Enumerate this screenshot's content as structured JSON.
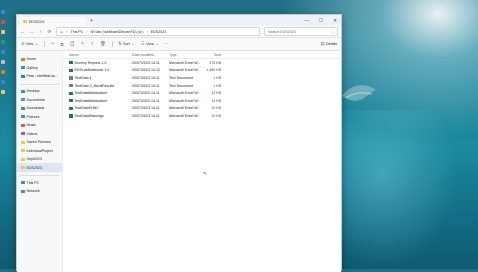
{
  "window": {
    "tab_title": "EDS2023",
    "win_controls": [
      "—",
      "☐",
      "✕"
    ],
    "new_tab": "+"
  },
  "address": {
    "crumbs": [
      "This PC",
      "NYJah (\\\\vMikael\\Drivrar\\FD) (U:)",
      "EDS2023"
    ],
    "search_placeholder": "Search EDS2023"
  },
  "toolbar": {
    "new": "New",
    "sort": "Sort",
    "view": "View",
    "more": "···",
    "details": "Details"
  },
  "sidebar": {
    "top": [
      {
        "label": "Home",
        "color": "#e77b27"
      },
      {
        "label": "Gallery",
        "color": "#3b8ad9"
      },
      {
        "label": "Peta - sheffield.ac...",
        "color": "#2f7ec9"
      }
    ],
    "quick": [
      {
        "label": "Desktop",
        "color": "#3a8bd6"
      },
      {
        "label": "Documents",
        "color": "#6b8fb3"
      },
      {
        "label": "Downloads",
        "color": "#2e9e5b"
      },
      {
        "label": "Pictures",
        "color": "#3b8ad9"
      },
      {
        "label": "Music",
        "color": "#e0584c"
      },
      {
        "label": "Videos",
        "color": "#8a5bd6"
      },
      {
        "label": "Saved Pictures",
        "color": "#f2c94c"
      },
      {
        "label": "IndividualProject",
        "color": "#f2c94c"
      },
      {
        "label": "Sept2023",
        "color": "#f2c94c"
      },
      {
        "label": "EDS2023",
        "color": "#f2c94c"
      }
    ],
    "bottom": [
      {
        "label": "This PC",
        "color": "#3a8bd6"
      },
      {
        "label": "Network",
        "color": "#3a8bd6"
      }
    ],
    "selected": "EDS2023"
  },
  "filelist": {
    "headers": [
      "Name",
      "Date modified",
      "Type",
      "Size"
    ],
    "rows": [
      {
        "name": "Dummy Reports 1.0",
        "date": "20/07/2023 14:11",
        "type": "Microsoft Excel W...",
        "size": "475 KB",
        "color": "#1e7b45"
      },
      {
        "name": "EDSLabNotebook 1.0",
        "date": "20/07/2023 14:12",
        "type": "Microsoft Excel W...",
        "size": "1,480 KB",
        "color": "#1e7b45"
      },
      {
        "name": "TestData 1",
        "date": "20/07/2023 14:11",
        "type": "Text Document",
        "size": "1 KB",
        "color": "#7a7a7a"
      },
      {
        "name": "TestData 2_literalResults",
        "date": "20/07/2023 14:11",
        "type": "Text Document",
        "size": "1 KB",
        "color": "#7a7a7a"
      },
      {
        "name": "TestDataMetabolism",
        "date": "20/07/2023 14:11",
        "type": "Microsoft Excel W...",
        "size": "13 KB",
        "color": "#1e7b45"
      },
      {
        "name": "TestDataMetabolism",
        "date": "20/07/2023 14:11",
        "type": "Microsoft Excel W...",
        "size": "14 KB",
        "color": "#1e7b45"
      },
      {
        "name": "TestDataSHNC",
        "date": "20/07/2023 14:11",
        "type": "Microsoft Excel W...",
        "size": "10 KB",
        "color": "#1e7b45"
      },
      {
        "name": "TestDataWarnings",
        "date": "20/07/2023 14:11",
        "type": "Microsoft Excel W...",
        "size": "10 KB",
        "color": "#1e7b45"
      }
    ]
  }
}
